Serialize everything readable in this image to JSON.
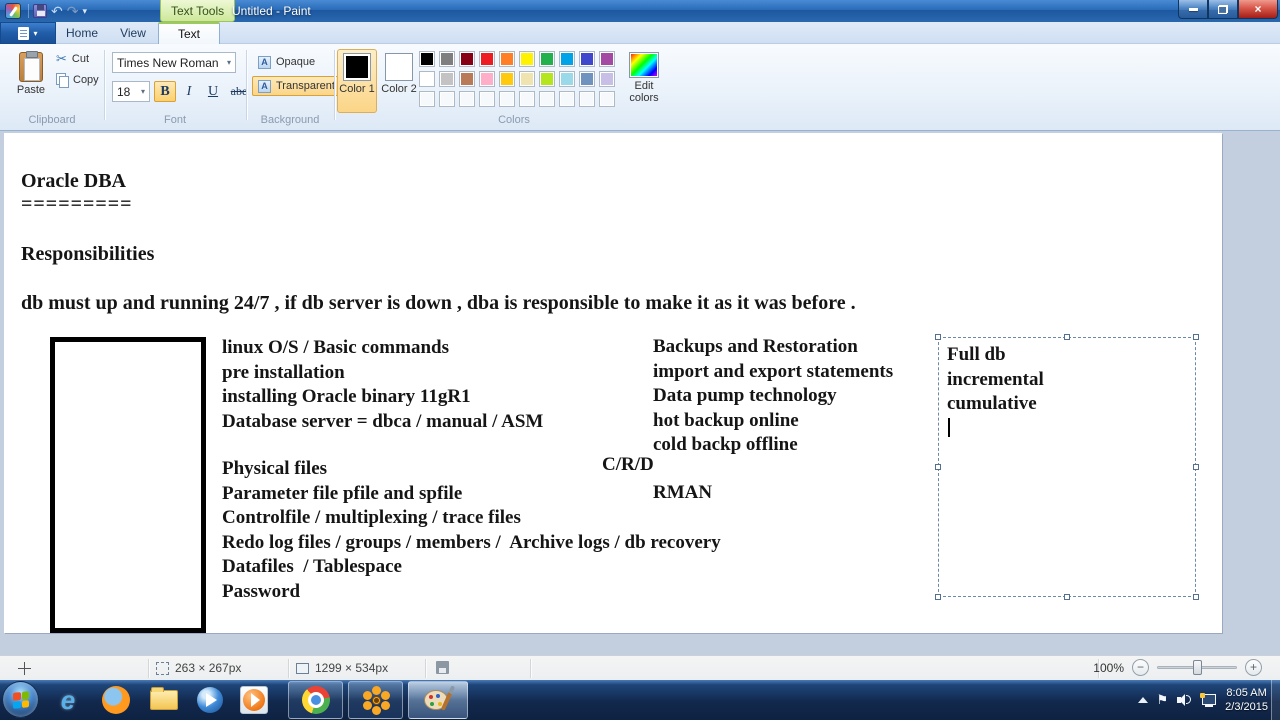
{
  "window": {
    "title": "Untitled - Paint",
    "context_tab_label": "Text Tools"
  },
  "icons": {
    "undo": "↶",
    "redo": "↷",
    "caret_down": "▾",
    "close": "×",
    "scissors": "✂",
    "minus": "−",
    "plus": "+",
    "tray_flag": "⚑"
  },
  "tabs": {
    "home": "Home",
    "view": "View",
    "text": "Text"
  },
  "ribbon": {
    "clipboard": {
      "label": "Clipboard",
      "paste": "Paste",
      "cut": "Cut",
      "copy": "Copy"
    },
    "font": {
      "label": "Font",
      "family": "Times New Roman",
      "size": "18",
      "bold": "B",
      "italic": "I",
      "underline": "U",
      "strikethrough": "abe"
    },
    "background": {
      "label": "Background",
      "opaque": "Opaque",
      "transparent": "Transparent",
      "ab_glyph": "A"
    },
    "colors": {
      "label": "Colors",
      "color1_label": "Color 1",
      "color2_label": "Color 2",
      "color1": "#000000",
      "color2": "#FFFFFF",
      "edit_colors_label": "Edit colors",
      "palette_row1": [
        "#000000",
        "#7F7F7F",
        "#880015",
        "#ED1C24",
        "#FF7F27",
        "#FFF200",
        "#22B14C",
        "#00A2E8",
        "#3F48CC",
        "#A349A4"
      ],
      "palette_row2": [
        "#FFFFFF",
        "#C3C3C3",
        "#B97A57",
        "#FFAEC9",
        "#FFC90E",
        "#EFE4B0",
        "#B5E61D",
        "#99D9EA",
        "#7092BE",
        "#C8BFE7"
      ],
      "palette_row3": [
        "",
        "",
        "",
        "",
        "",
        "",
        "",
        "",
        "",
        ""
      ]
    }
  },
  "document": {
    "title": "Oracle DBA",
    "title_underline": "=========",
    "subtitle": "Responsibilities",
    "paragraph": "db must up and running 24/7 , if db server is down , dba is responsible to make it as it was before .",
    "column1_top": [
      "linux O/S / Basic commands",
      "pre installation",
      "installing Oracle binary 11gR1",
      "Database server = dbca / manual / ASM"
    ],
    "column1_bottom": [
      "Physical files",
      "Parameter file pfile and spfile",
      "Controlfile / multiplexing / trace files",
      "Redo log files / groups / members /  Archive logs / db recovery",
      "Datafiles  / Tablespace",
      "Password"
    ],
    "column2": [
      "Backups and Restoration",
      "import and export statements",
      "Data pump technology",
      "hot backup online",
      "cold backp offline"
    ],
    "crd": "C/R/D",
    "rman": "RMAN",
    "textbox_lines": [
      "Full db",
      "incremental",
      "cumulative"
    ]
  },
  "statusbar": {
    "selection_size": "263 × 267px",
    "image_size": "1299 × 534px",
    "zoom_level": "100%"
  },
  "taskbar": {
    "clock_time": "8:05 AM",
    "clock_date": "2/3/2015"
  },
  "ui_colors": {
    "titlebar_blue": "#2A6CB8",
    "context_tab_green": "#CDE89A",
    "active_highlight_orange": "#FBD06E",
    "taskbar_blue": "#12284C",
    "canvas_white": "#FFFFFF"
  }
}
